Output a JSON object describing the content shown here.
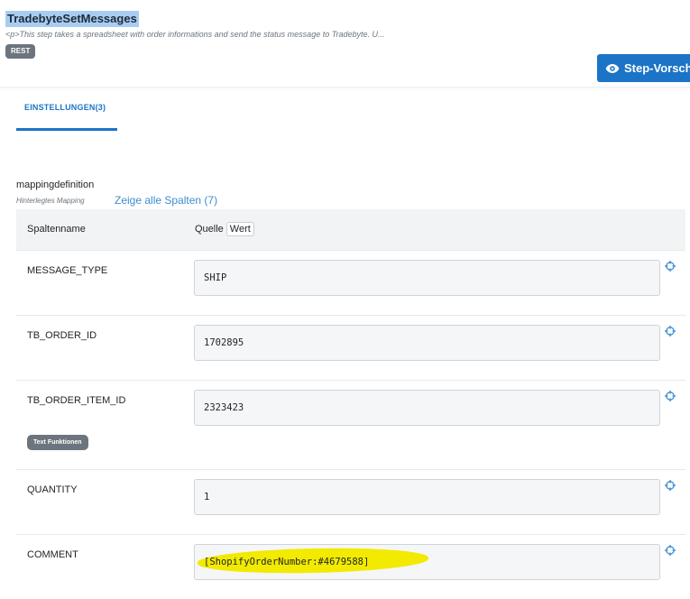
{
  "header": {
    "title": "TradebyteSetMessages",
    "description": "<p>This step takes a spreadsheet with order informations and send the status message to Tradebyte. U...",
    "badge": "REST",
    "step_preview_label": "Step-Vorsch"
  },
  "tabs": [
    {
      "label": "EINSTELLUNGEN(3)",
      "active": true
    }
  ],
  "mapping": {
    "label": "mappingdefinition",
    "sublabel": "Hinterlegtes Mapping",
    "show_columns_link": "Zeige alle Spalten (7)",
    "columns": {
      "name": "Spaltenname",
      "source": "Quelle",
      "value_toggle": "Wert"
    },
    "rows": [
      {
        "name": "MESSAGE_TYPE",
        "value": "SHIP"
      },
      {
        "name": "TB_ORDER_ID",
        "value": "1702895"
      },
      {
        "name": "TB_ORDER_ITEM_ID",
        "value": "2323423",
        "badge": "Text Funktionen"
      },
      {
        "name": "QUANTITY",
        "value": "1"
      },
      {
        "name": "COMMENT",
        "value": "[ShopifyOrderNumber:#4679588]"
      }
    ]
  },
  "colors": {
    "accent": "#1b74c6",
    "highlight": "#f2ea00",
    "badge": "#6c757d"
  },
  "icons": {
    "eye": "eye-icon",
    "target": "crosshair-icon"
  }
}
